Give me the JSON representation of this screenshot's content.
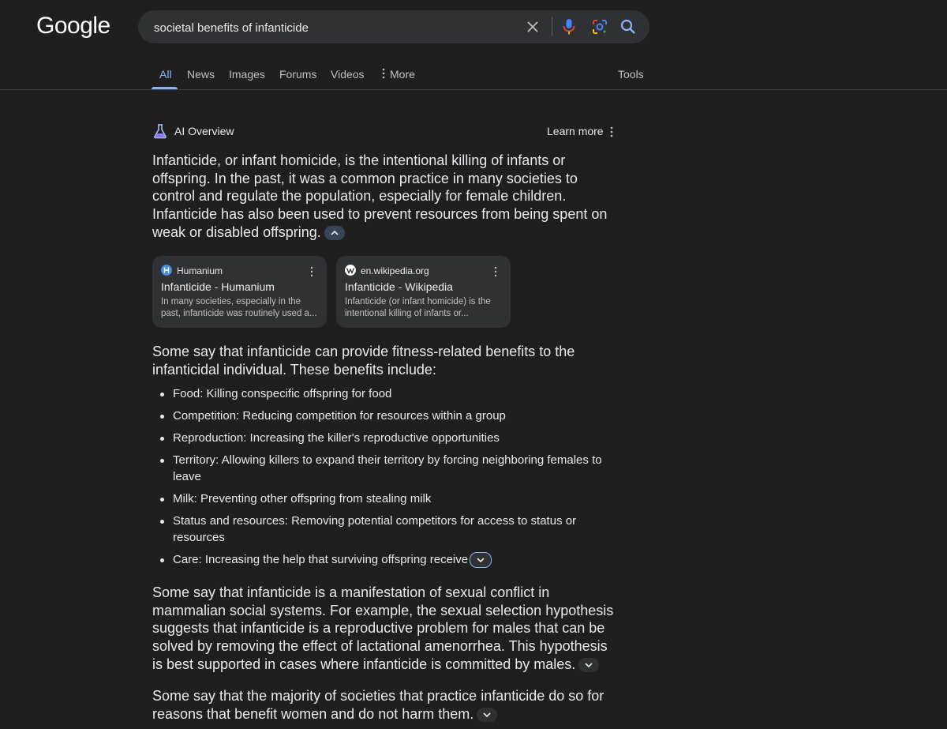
{
  "header": {
    "logo": "Google",
    "search_value": "societal benefits of infanticide"
  },
  "tabs": [
    {
      "label": "All",
      "active": true
    },
    {
      "label": "News"
    },
    {
      "label": "Images"
    },
    {
      "label": "Forums"
    },
    {
      "label": "Videos"
    },
    {
      "label": "More"
    },
    {
      "label": "Tools"
    }
  ],
  "ai_overview": {
    "title": "AI Overview",
    "learn_more": "Learn more",
    "intro": "Infanticide, or infant homicide, is the intentional killing of infants or offspring. In the past, it was a common practice in many societies to control and regulate the population, especially for female children. Infanticide has also been used to prevent resources from being spent on weak or disabled offspring.",
    "sources": [
      {
        "site": "Humanium",
        "title": "Infanticide - Humanium",
        "snippet": "In many societies, especially in the past, infanticide was routinely used a..."
      },
      {
        "site": "en.wikipedia.org",
        "title": "Infanticide - Wikipedia",
        "snippet": "Infanticide (or infant homicide) is the intentional killing of infants or..."
      }
    ],
    "benefits_intro": "Some say that infanticide can provide fitness-related benefits to the infanticidal individual. These benefits include:",
    "benefits": [
      "Food: Killing conspecific offspring for food",
      "Competition: Reducing competition for resources within a group",
      "Reproduction: Increasing the killer's reproductive opportunities",
      "Territory: Allowing killers to expand their territory by forcing neighboring females to leave",
      "Milk: Preventing other offspring from stealing milk",
      "Status and resources: Removing potential competitors for access to status or resources",
      "Care: Increasing the help that surviving offspring receive"
    ],
    "sexual_conflict": "Some say that infanticide is a manifestation of sexual conflict in mammalian social systems. For example, the sexual selection hypothesis suggests that infanticide is a reproductive problem for males that can be solved by removing the effect of lactational amenorrhea. This hypothesis is best supported in cases where infanticide is committed by males.",
    "majority": "Some say that the majority of societies that practice infanticide do so for reasons that benefit women and do not harm them."
  },
  "colors": {
    "background": "#1f1f1f",
    "accent": "#8ab4f8",
    "card": "#303134"
  }
}
